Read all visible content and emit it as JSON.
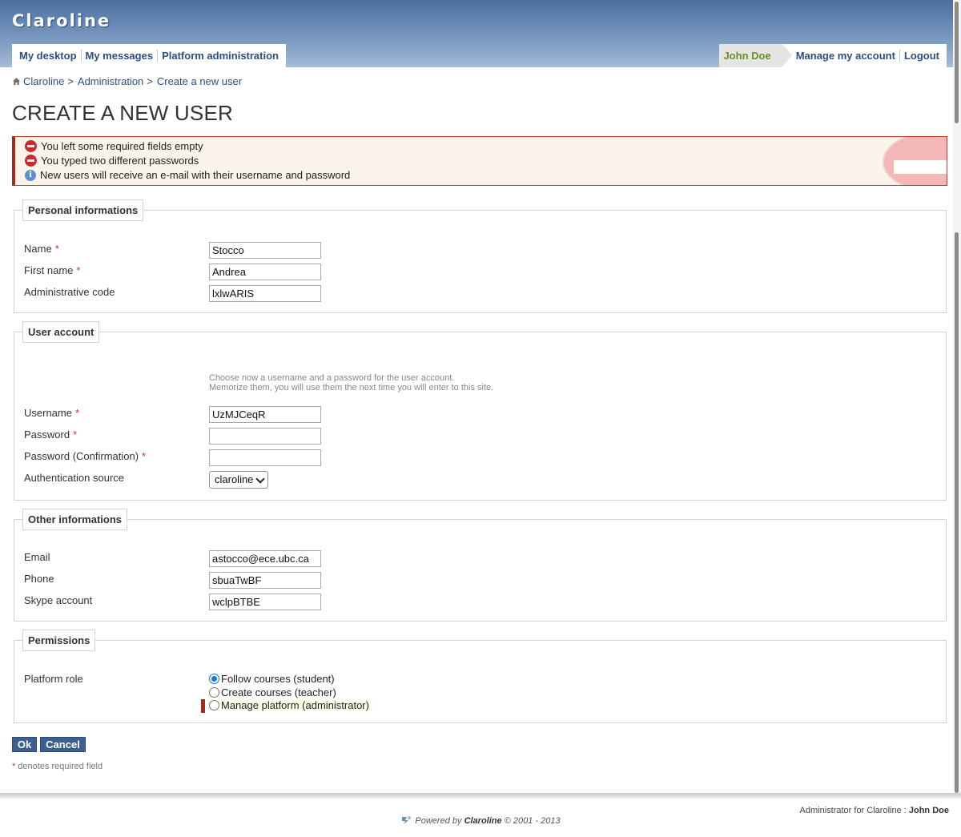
{
  "app": {
    "name": "Claroline"
  },
  "nav": {
    "left": [
      "My desktop",
      "My messages",
      "Platform administration"
    ],
    "user": "John Doe",
    "manage": "Manage my account",
    "logout": "Logout"
  },
  "breadcrumb": {
    "home": "Claroline",
    "admin": "Administration",
    "current": "Create a new user",
    "sep": ">"
  },
  "page": {
    "title": "CREATE A NEW USER"
  },
  "messages": {
    "error1": "You left some required fields empty",
    "error2": "You typed two different passwords",
    "info": "New users will receive an e-mail with their username and password"
  },
  "personal": {
    "legend": "Personal informations",
    "name_label": "Name",
    "name_value": "Stocco",
    "firstname_label": "First name",
    "firstname_value": "Andrea",
    "admincode_label": "Administrative code",
    "admincode_value": "lxlwARIS"
  },
  "account": {
    "legend": "User account",
    "hint1": "Choose now a username and a password for the user account.",
    "hint2": "Memorize them, you will use them the next time you will enter to this site.",
    "username_label": "Username",
    "username_value": "UzMJCeqR",
    "password_label": "Password",
    "password_value": "",
    "confirm_label": "Password (Confirmation)",
    "confirm_value": "",
    "auth_label": "Authentication source",
    "auth_value": "claroline"
  },
  "other": {
    "legend": "Other informations",
    "email_label": "Email",
    "email_value": "astocco@ece.ubc.ca",
    "phone_label": "Phone",
    "phone_value": "sbuaTwBF",
    "skype_label": "Skype account",
    "skype_value": "wclpBTBE"
  },
  "permissions": {
    "legend": "Permissions",
    "role_label": "Platform role",
    "options": [
      "Follow courses (student)",
      "Create courses (teacher)",
      "Manage platform (administrator)"
    ],
    "selected_index": 0
  },
  "form": {
    "ok": "Ok",
    "cancel": "Cancel",
    "required_mark": "*",
    "required_note": "denotes required field"
  },
  "footer": {
    "admin_text": "Administrator for Claroline :",
    "admin_name": "John Doe",
    "powered_prefix": "Powered by",
    "powered_brand": "Claroline",
    "powered_suffix": "© 2001 - 2013"
  },
  "colors": {
    "accent": "#2a4f82",
    "header": "#5b7fab",
    "error": "#cc2b2b",
    "button": "#3d5f8e",
    "user": "#6b8f2a"
  }
}
